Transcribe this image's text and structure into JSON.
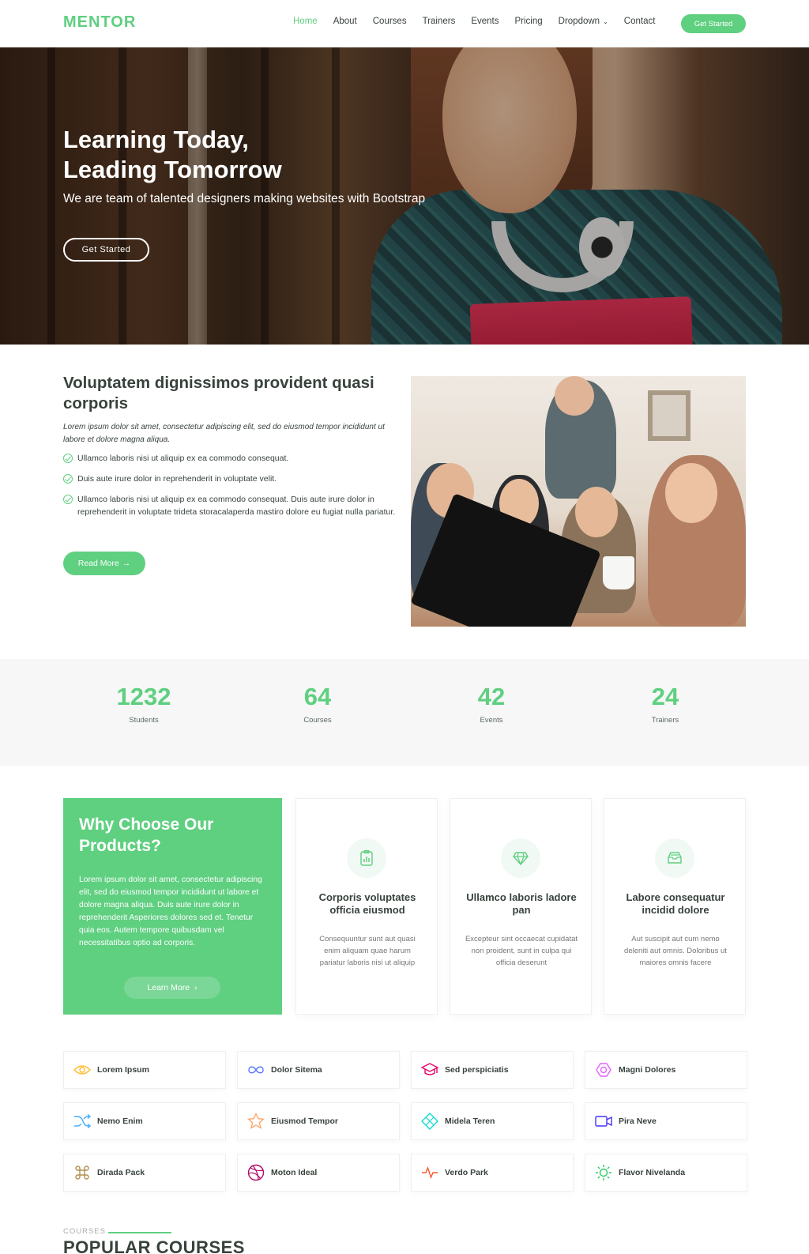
{
  "header": {
    "logo": "MENTOR",
    "nav": [
      "Home",
      "About",
      "Courses",
      "Trainers",
      "Events",
      "Pricing",
      "Dropdown",
      "Contact"
    ],
    "cta": "Get Started"
  },
  "hero": {
    "title_line1": "Learning Today,",
    "title_line2": "Leading Tomorrow",
    "subtitle": "We are team of talented designers making websites with Bootstrap",
    "button": "Get Started"
  },
  "about": {
    "title": "Voluptatem dignissimos provident quasi corporis",
    "intro": "Lorem ipsum dolor sit amet, consectetur adipiscing elit, sed do eiusmod tempor incididunt ut labore et dolore magna aliqua.",
    "points": [
      "Ullamco laboris nisi ut aliquip ex ea commodo consequat.",
      "Duis aute irure dolor in reprehenderit in voluptate velit.",
      "Ullamco laboris nisi ut aliquip ex ea commodo consequat. Duis aute irure dolor in reprehenderit in voluptate trideta storacalaperda mastiro dolore eu fugiat nulla pariatur."
    ],
    "button": "Read More"
  },
  "counts": [
    {
      "value": "1232",
      "label": "Students"
    },
    {
      "value": "64",
      "label": "Courses"
    },
    {
      "value": "42",
      "label": "Events"
    },
    {
      "value": "24",
      "label": "Trainers"
    }
  ],
  "why": {
    "title": "Why Choose Our Products?",
    "text": "Lorem ipsum dolor sit amet, consectetur adipiscing elit, sed do eiusmod tempor incididunt ut labore et dolore magna aliqua. Duis aute irure dolor in reprehenderit Asperiores dolores sed et. Tenetur quia eos. Autem tempore quibusdam vel necessitatibus optio ad corporis.",
    "button": "Learn More",
    "cards": [
      {
        "icon": "clipboard-chart-icon",
        "title": "Corporis voluptates officia eiusmod",
        "text": "Consequuntur sunt aut quasi enim aliquam quae harum pariatur laboris nisi ut aliquip"
      },
      {
        "icon": "gem-icon",
        "title": "Ullamco laboris ladore pan",
        "text": "Excepteur sint occaecat cupidatat non proident, sunt in culpa qui officia deserunt"
      },
      {
        "icon": "inbox-icon",
        "title": "Labore consequatur incidid dolore",
        "text": "Aut suscipit aut cum nemo deleniti aut omnis. Doloribus ut maiores omnis facere"
      }
    ]
  },
  "features": [
    {
      "label": "Lorem Ipsum",
      "icon": "eye-icon",
      "color": "#ffbb2c"
    },
    {
      "label": "Dolor Sitema",
      "icon": "infinity-icon",
      "color": "#5578ff"
    },
    {
      "label": "Sed perspiciatis",
      "icon": "mortarboard-icon",
      "color": "#e80368"
    },
    {
      "label": "Magni Dolores",
      "icon": "nut-icon",
      "color": "#e361ff"
    },
    {
      "label": "Nemo Enim",
      "icon": "shuffle-icon",
      "color": "#47aeff"
    },
    {
      "label": "Eiusmod Tempor",
      "icon": "star-icon",
      "color": "#ffa76e"
    },
    {
      "label": "Midela Teren",
      "icon": "diamond-icon",
      "color": "#11dbcf"
    },
    {
      "label": "Pira Neve",
      "icon": "camera-video-icon",
      "color": "#4233ff"
    },
    {
      "label": "Dirada Pack",
      "icon": "command-icon",
      "color": "#b2904f"
    },
    {
      "label": "Moton Ideal",
      "icon": "dribbble-icon",
      "color": "#b20969"
    },
    {
      "label": "Verdo Park",
      "icon": "activity-icon",
      "color": "#ff5828"
    },
    {
      "label": "Flavor Nivelanda",
      "icon": "brightness-icon",
      "color": "#29cc61"
    }
  ],
  "courses_section": {
    "eyebrow": "COURSES",
    "title": "POPULAR COURSES"
  },
  "colors": {
    "accent": "#5fcf80",
    "text": "#37423b"
  }
}
